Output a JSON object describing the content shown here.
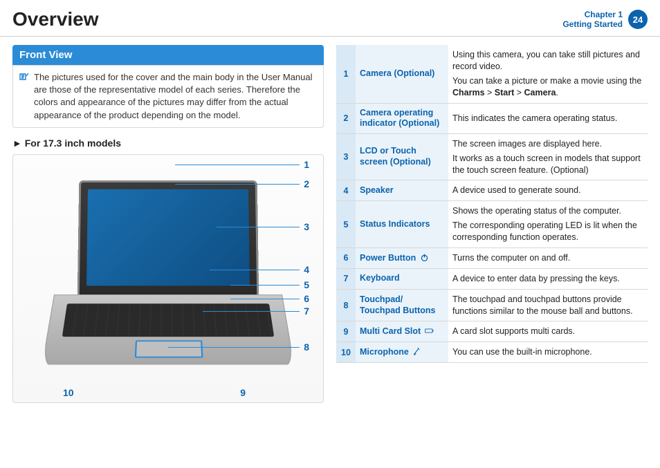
{
  "header": {
    "title": "Overview",
    "chapter_line1": "Chapter 1",
    "chapter_line2": "Getting Started",
    "page_number": "24"
  },
  "left": {
    "section_title": "Front View",
    "note": "The pictures used for the cover and the main body in the User Manual are those of the representative model of each series. Therefore the colors and appearance of the pictures may differ from the actual appearance of the product depending on the model.",
    "subhead": "For 17.3 inch models",
    "callouts": [
      "1",
      "2",
      "3",
      "4",
      "5",
      "6",
      "7",
      "8",
      "9",
      "10"
    ]
  },
  "parts": [
    {
      "num": "1",
      "name": "Camera (Optional)",
      "desc": [
        "Using this camera, you can take still pictures and record video.",
        "You can take a picture or make a movie using the <b>Charms</b> > <b>Start</b> > <b>Camera</b>."
      ]
    },
    {
      "num": "2",
      "name": "Camera operating indicator (Optional)",
      "desc": [
        "This indicates the camera operating status."
      ]
    },
    {
      "num": "3",
      "name": "LCD or Touch screen (Optional)",
      "desc": [
        "The screen images are displayed here.",
        "It works as a touch screen in models that support the touch screen feature. (Optional)"
      ]
    },
    {
      "num": "4",
      "name": "Speaker",
      "desc": [
        "A device used to generate sound."
      ]
    },
    {
      "num": "5",
      "name": "Status Indicators",
      "desc": [
        "Shows the operating status of the computer.",
        "The corresponding operating LED is lit when the corresponding function operates."
      ]
    },
    {
      "num": "6",
      "name": "Power Button",
      "icon": "power-icon",
      "desc": [
        "Turns the computer on and off."
      ]
    },
    {
      "num": "7",
      "name": "Keyboard",
      "desc": [
        "A device to enter data by pressing the keys."
      ]
    },
    {
      "num": "8",
      "name": "Touchpad/ Touchpad Buttons",
      "desc": [
        "The touchpad and touchpad buttons provide functions similar to the mouse ball and buttons."
      ]
    },
    {
      "num": "9",
      "name": "Multi Card Slot",
      "icon": "card-icon",
      "desc": [
        "A card slot supports multi cards."
      ]
    },
    {
      "num": "10",
      "name": "Microphone",
      "icon": "mic-icon",
      "desc": [
        "You can use the built-in microphone."
      ]
    }
  ]
}
